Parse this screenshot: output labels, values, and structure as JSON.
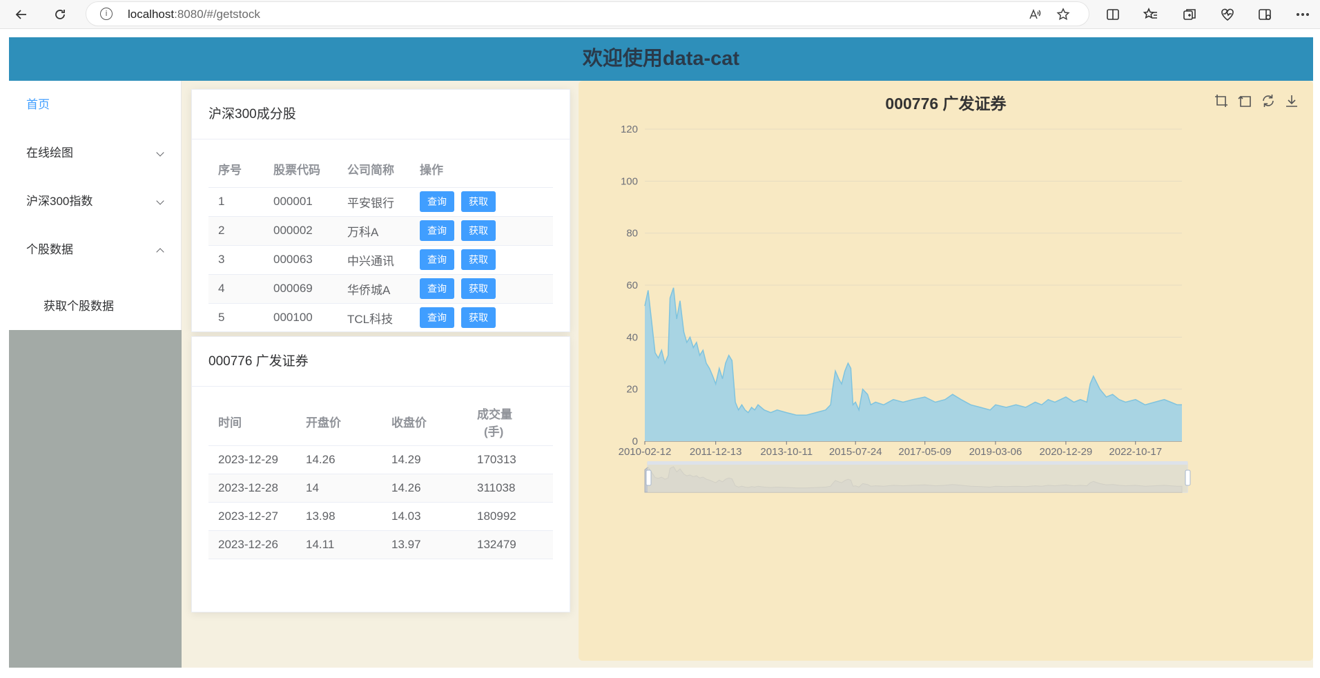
{
  "browser": {
    "url_host": "localhost",
    "url_rest": ":8080/#/getstock",
    "info_icon": "info-icon",
    "read_aloud_label": "A⁾"
  },
  "header": {
    "title": "欢迎使用data-cat"
  },
  "sidebar": {
    "items": [
      {
        "label": "首页",
        "active": true
      },
      {
        "label": "在线绘图"
      },
      {
        "label": "沪深300指数"
      },
      {
        "label": "个股数据"
      }
    ],
    "submenu": {
      "label": "获取个股数据"
    }
  },
  "components_card": {
    "title": "沪深300成分股",
    "columns": [
      "序号",
      "股票代码",
      "公司简称",
      "操作"
    ],
    "rows": [
      {
        "no": "1",
        "code": "000001",
        "name": "平安银行"
      },
      {
        "no": "2",
        "code": "000002",
        "name": "万科A"
      },
      {
        "no": "3",
        "code": "000063",
        "name": "中兴通讯"
      },
      {
        "no": "4",
        "code": "000069",
        "name": "华侨城A"
      },
      {
        "no": "5",
        "code": "000100",
        "name": "TCL科技"
      }
    ],
    "query_label": "查询",
    "fetch_label": "获取"
  },
  "stock_card": {
    "title": "000776 广发证券",
    "columns": [
      "时间",
      "开盘价",
      "收盘价",
      "成交量",
      "(手)"
    ],
    "rows": [
      {
        "date": "2023-12-29",
        "open": "14.26",
        "close": "14.29",
        "volume": "170313"
      },
      {
        "date": "2023-12-28",
        "open": "14",
        "close": "14.26",
        "volume": "311038"
      },
      {
        "date": "2023-12-27",
        "open": "13.98",
        "close": "14.03",
        "volume": "180992"
      },
      {
        "date": "2023-12-26",
        "open": "14.11",
        "close": "13.97",
        "volume": "132479"
      }
    ]
  },
  "chart_data": {
    "type": "area",
    "title": "000776 广发证券",
    "xlabel": "",
    "ylabel": "",
    "ylim": [
      0,
      120
    ],
    "yticks": [
      0,
      20,
      40,
      60,
      80,
      100,
      120
    ],
    "x_tick_labels": [
      "2010-02-12",
      "2011-12-13",
      "2013-10-11",
      "2015-07-24",
      "2017-05-09",
      "2019-03-06",
      "2020-12-29",
      "2022-10-17"
    ],
    "x_range": [
      "2010-02-12",
      "2023-12-29"
    ],
    "grid": true,
    "fill_color": "#a8d4e3",
    "line_color": "#7fc3de",
    "x": [
      "2010-02-12",
      "2010-03-15",
      "2010-04-20",
      "2010-05-20",
      "2010-06-20",
      "2010-07-20",
      "2010-08-20",
      "2010-09-20",
      "2010-10-08",
      "2010-11-10",
      "2010-12-10",
      "2011-01-10",
      "2011-02-15",
      "2011-03-15",
      "2011-04-15",
      "2011-05-16",
      "2011-06-15",
      "2011-07-15",
      "2011-08-15",
      "2011-09-15",
      "2011-10-15",
      "2011-11-15",
      "2011-12-13",
      "2012-01-15",
      "2012-02-15",
      "2012-03-15",
      "2012-04-15",
      "2012-05-15",
      "2012-06-15",
      "2012-07-15",
      "2012-08-15",
      "2012-09-15",
      "2012-10-15",
      "2012-11-15",
      "2012-12-15",
      "2013-01-15",
      "2013-03-15",
      "2013-05-15",
      "2013-07-15",
      "2013-10-11",
      "2014-01-15",
      "2014-04-15",
      "2014-07-15",
      "2014-10-15",
      "2014-12-01",
      "2014-12-20",
      "2015-01-15",
      "2015-02-15",
      "2015-03-15",
      "2015-04-15",
      "2015-05-15",
      "2015-06-10",
      "2015-06-30",
      "2015-07-24",
      "2015-08-25",
      "2015-09-30",
      "2015-11-15",
      "2015-12-15",
      "2016-01-30",
      "2016-04-15",
      "2016-07-15",
      "2016-10-15",
      "2017-01-15",
      "2017-05-09",
      "2017-08-15",
      "2017-11-15",
      "2018-01-25",
      "2018-04-15",
      "2018-07-15",
      "2018-10-15",
      "2019-01-15",
      "2019-03-06",
      "2019-06-15",
      "2019-09-15",
      "2019-12-15",
      "2020-03-15",
      "2020-05-15",
      "2020-07-15",
      "2020-09-15",
      "2020-12-29",
      "2021-03-15",
      "2021-05-15",
      "2021-07-15",
      "2021-08-15",
      "2021-09-15",
      "2021-11-15",
      "2022-01-15",
      "2022-03-15",
      "2022-05-15",
      "2022-07-15",
      "2022-10-17",
      "2023-01-15",
      "2023-04-15",
      "2023-07-15",
      "2023-09-15",
      "2023-11-15",
      "2023-12-29"
    ],
    "values": [
      52,
      58,
      45,
      34,
      32,
      35,
      30,
      33,
      55,
      59,
      47,
      54,
      42,
      38,
      40,
      36,
      38,
      33,
      35,
      30,
      28,
      25,
      22,
      28,
      24,
      30,
      33,
      31,
      15,
      12,
      14,
      12,
      11,
      13,
      12,
      14,
      12,
      11,
      12,
      11,
      10,
      10,
      11,
      12,
      14,
      20,
      27,
      24,
      22,
      27,
      30,
      28,
      14,
      15,
      12,
      20,
      18,
      14,
      15,
      14,
      16,
      15,
      16,
      17,
      15,
      16,
      18,
      16,
      14,
      13,
      12,
      14,
      13,
      14,
      13,
      15,
      14,
      16,
      15,
      17,
      15,
      16,
      15,
      22,
      25,
      20,
      17,
      18,
      16,
      15,
      16,
      14,
      15,
      16,
      15,
      14,
      14
    ],
    "zoom_slider": {
      "start_pct": 0,
      "end_pct": 100
    }
  }
}
